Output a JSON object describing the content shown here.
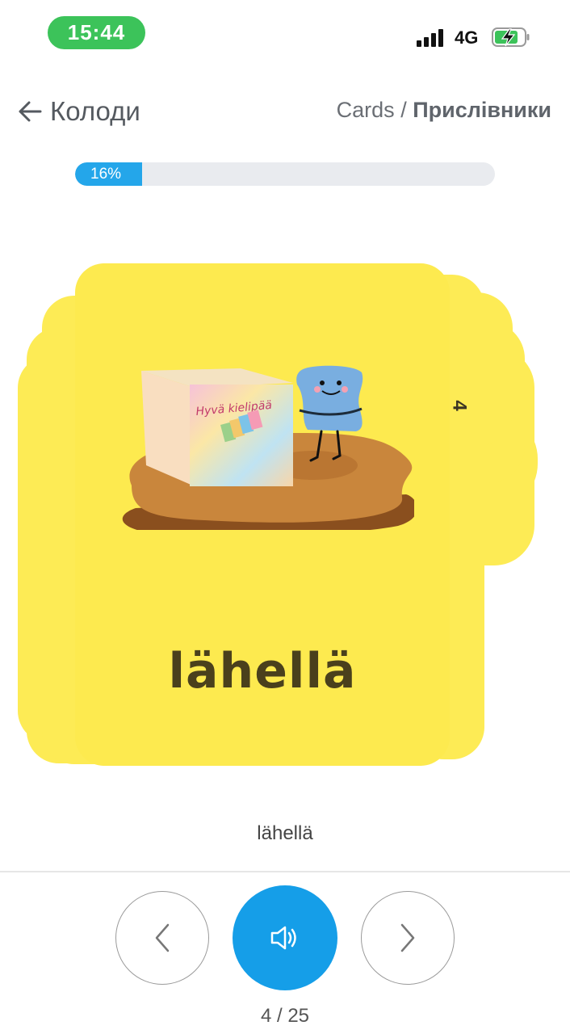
{
  "status_bar": {
    "time": "15:44",
    "network": "4G",
    "time_color": "#3cc35a"
  },
  "header": {
    "back_label": "Колоди",
    "breadcrumb_root": "Cards",
    "breadcrumb_separator": " / ",
    "breadcrumb_current": "Прислівники"
  },
  "progress": {
    "percent": 16,
    "label": "16%",
    "color": "#24a6ea"
  },
  "card": {
    "word": "lähellä",
    "box_label": "Hyvä kielipää",
    "next_card_number": "4",
    "background": "#fdea4f"
  },
  "caption": "lähellä",
  "controls": {
    "prev_icon": "chevron-left-icon",
    "audio_icon": "speaker-icon",
    "next_icon": "chevron-right-icon",
    "audio_color": "#159ee8"
  },
  "counter": "4 / 25"
}
